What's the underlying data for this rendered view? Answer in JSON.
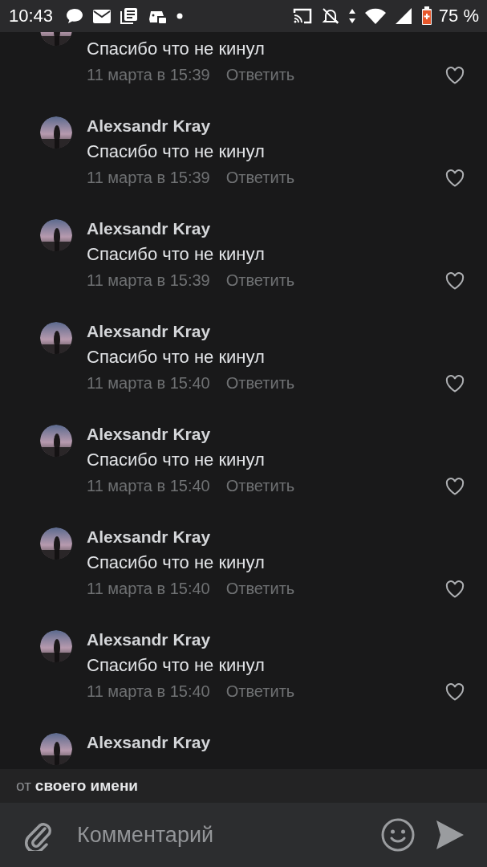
{
  "status_bar": {
    "time": "10:43",
    "battery": "75 %"
  },
  "comments": [
    {
      "text": "Спасибо что не кинул",
      "date": "11 марта в 15:39",
      "reply": "Ответить"
    },
    {
      "author": "Alexsandr Kray",
      "text": "Спасибо что не кинул",
      "date": "11 марта в 15:39",
      "reply": "Ответить"
    },
    {
      "author": "Alexsandr Kray",
      "text": "Спасибо что не кинул",
      "date": "11 марта в 15:39",
      "reply": "Ответить"
    },
    {
      "author": "Alexsandr Kray",
      "text": "Спасибо что не кинул",
      "date": "11 марта в 15:40",
      "reply": "Ответить"
    },
    {
      "author": "Alexsandr Kray",
      "text": "Спасибо что не кинул",
      "date": "11 марта в 15:40",
      "reply": "Ответить"
    },
    {
      "author": "Alexsandr Kray",
      "text": "Спасибо что не кинул",
      "date": "11 марта в 15:40",
      "reply": "Ответить"
    },
    {
      "author": "Alexsandr Kray",
      "text": "Спасибо что не кинул",
      "date": "11 марта в 15:40",
      "reply": "Ответить"
    },
    {
      "author": "Alexsandr Kray"
    }
  ],
  "sender": {
    "prefix": "от",
    "name": "своего имени"
  },
  "composer": {
    "placeholder": "Комментарий"
  }
}
